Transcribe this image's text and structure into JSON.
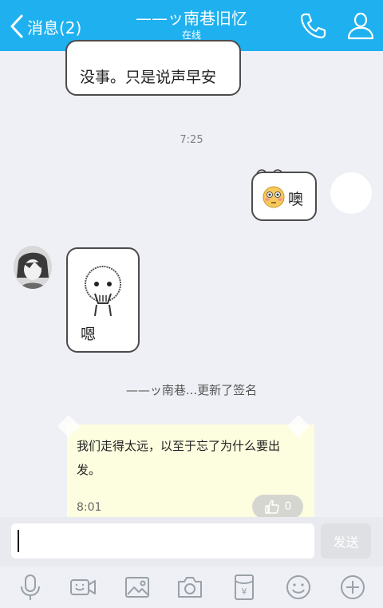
{
  "header": {
    "back_label": "消息(2)",
    "title": "——ッ南巷旧忆",
    "status": "在线",
    "bg_color": "#1fb1ef"
  },
  "messages": {
    "top_text": "没事。只是说声早安",
    "time_1": "7:25",
    "right_text": "噢",
    "right_emoji": "flushed-face-emoji",
    "left_text": "嗯",
    "left_sticker": "covering-mouth-sticker"
  },
  "notice": {
    "text": "——ッ南巷...更新了签名"
  },
  "signature_card": {
    "text": "我们走得太远，以至于忘了为什么要出发。",
    "time": "8:01",
    "like_count": "0",
    "bg_color": "#fdfde0"
  },
  "input": {
    "value": "",
    "placeholder": "",
    "send_label": "发送"
  },
  "toolbar": {
    "icons": [
      "microphone-icon",
      "video-icon",
      "image-icon",
      "camera-icon",
      "red-envelope-icon",
      "emoji-icon",
      "plus-icon"
    ]
  }
}
